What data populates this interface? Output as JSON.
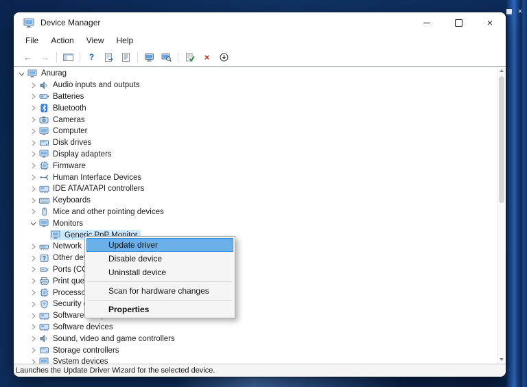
{
  "desktop": {
    "background_window_controls": [
      "maximize",
      "close"
    ]
  },
  "window": {
    "title": "Device Manager",
    "controls": [
      {
        "name": "minimize"
      },
      {
        "name": "maximize"
      },
      {
        "name": "close"
      }
    ]
  },
  "menubar": {
    "items": [
      "File",
      "Action",
      "View",
      "Help"
    ]
  },
  "toolbar": {
    "icons": [
      "back",
      "forward",
      "separator",
      "console-tree",
      "separator",
      "help",
      "export-list",
      "properties-page",
      "separator",
      "computer-manage",
      "scan-monitor",
      "separator",
      "update-driver",
      "uninstall",
      "disable"
    ]
  },
  "tree": {
    "items": [
      {
        "label": "Anurag",
        "icon": "computer",
        "level": 0,
        "chevron": "expanded"
      },
      {
        "label": "Audio inputs and outputs",
        "icon": "audio",
        "level": 1,
        "chevron": "collapsed"
      },
      {
        "label": "Batteries",
        "icon": "battery",
        "level": 1,
        "chevron": "collapsed"
      },
      {
        "label": "Bluetooth",
        "icon": "bluetooth",
        "level": 1,
        "chevron": "collapsed"
      },
      {
        "label": "Cameras",
        "icon": "camera",
        "level": 1,
        "chevron": "collapsed"
      },
      {
        "label": "Computer",
        "icon": "computer",
        "level": 1,
        "chevron": "collapsed"
      },
      {
        "label": "Disk drives",
        "icon": "disk",
        "level": 1,
        "chevron": "collapsed"
      },
      {
        "label": "Display adapters",
        "icon": "display",
        "level": 1,
        "chevron": "collapsed"
      },
      {
        "label": "Firmware",
        "icon": "firmware",
        "level": 1,
        "chevron": "collapsed"
      },
      {
        "label": "Human Interface Devices",
        "icon": "hid",
        "level": 1,
        "chevron": "collapsed"
      },
      {
        "label": "IDE ATA/ATAPI controllers",
        "icon": "ide",
        "level": 1,
        "chevron": "collapsed"
      },
      {
        "label": "Keyboards",
        "icon": "keyboard",
        "level": 1,
        "chevron": "collapsed"
      },
      {
        "label": "Mice and other pointing devices",
        "icon": "mouse",
        "level": 1,
        "chevron": "collapsed"
      },
      {
        "label": "Monitors",
        "icon": "monitor",
        "level": 1,
        "chevron": "expanded"
      },
      {
        "label": "Generic PnP Monitor",
        "icon": "monitor",
        "level": 2,
        "chevron": null,
        "selected": true
      },
      {
        "label": "Network adapters",
        "icon": "network",
        "level": 1,
        "chevron": "collapsed"
      },
      {
        "label": "Other devices",
        "icon": "other",
        "level": 1,
        "chevron": "collapsed"
      },
      {
        "label": "Ports (COM & LPT)",
        "icon": "ports",
        "level": 1,
        "chevron": "collapsed"
      },
      {
        "label": "Print queues",
        "icon": "printer",
        "level": 1,
        "chevron": "collapsed"
      },
      {
        "label": "Processors",
        "icon": "cpu",
        "level": 1,
        "chevron": "collapsed"
      },
      {
        "label": "Security devices",
        "icon": "security",
        "level": 1,
        "chevron": "collapsed"
      },
      {
        "label": "Software components",
        "icon": "software",
        "level": 1,
        "chevron": "collapsed"
      },
      {
        "label": "Software devices",
        "icon": "software",
        "level": 1,
        "chevron": "collapsed"
      },
      {
        "label": "Sound, video and game controllers",
        "icon": "sound",
        "level": 1,
        "chevron": "collapsed"
      },
      {
        "label": "Storage controllers",
        "icon": "storage",
        "level": 1,
        "chevron": "collapsed"
      },
      {
        "label": "System devices",
        "icon": "system",
        "level": 1,
        "chevron": "collapsed"
      }
    ]
  },
  "context_menu": {
    "items": [
      {
        "label": "Update driver",
        "highlighted": true
      },
      {
        "label": "Disable device"
      },
      {
        "label": "Uninstall device"
      },
      {
        "separator": true
      },
      {
        "label": "Scan for hardware changes"
      },
      {
        "separator": true
      },
      {
        "label": "Properties",
        "bold": true
      }
    ]
  },
  "statusbar": {
    "text": "Launches the Update Driver Wizard for the selected device."
  },
  "colors": {
    "tree_selection": "#cce8ff",
    "menu_highlight": "#6cb0ea",
    "wallpaper": "#0c2a57"
  }
}
